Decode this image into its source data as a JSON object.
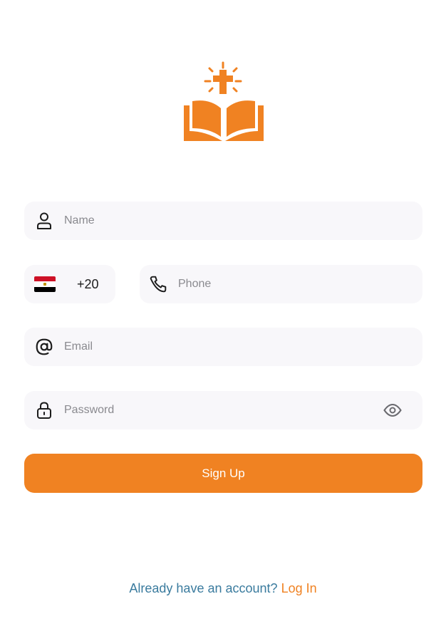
{
  "colors": {
    "accent": "#f08222",
    "field_bg": "#f8f7fa",
    "prompt_text": "#3a7b9e",
    "placeholder": "#8a8a8f"
  },
  "logo": {
    "icon": "bible-cross-icon"
  },
  "form": {
    "name": {
      "placeholder": "Name",
      "icon": "user-icon"
    },
    "country": {
      "flag": "egypt-flag-icon",
      "code": "+20"
    },
    "phone": {
      "placeholder": "Phone",
      "icon": "phone-icon"
    },
    "email": {
      "placeholder": "Email",
      "icon": "at-icon"
    },
    "password": {
      "placeholder": "Password",
      "icon": "lock-icon",
      "toggle_icon": "eye-icon"
    },
    "submit_label": "Sign Up"
  },
  "footer": {
    "prompt": "Already have an account?",
    "login_label": "Log In"
  }
}
